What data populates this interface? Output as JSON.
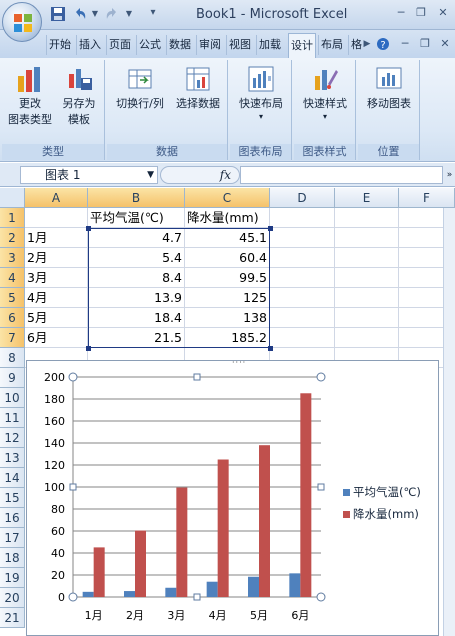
{
  "window": {
    "title": "Book1 - Microsoft Excel",
    "controls": {
      "minimize": "─",
      "restore": "❐",
      "close": "✕"
    }
  },
  "tabs": [
    {
      "label": "开始"
    },
    {
      "label": "插入"
    },
    {
      "label": "页面"
    },
    {
      "label": "公式"
    },
    {
      "label": "数据"
    },
    {
      "label": "审阅"
    },
    {
      "label": "视图"
    },
    {
      "label": "加载"
    },
    {
      "label": "设计",
      "active": true
    },
    {
      "label": "布局"
    },
    {
      "label": "格"
    }
  ],
  "ribbon": {
    "groups": [
      {
        "label": "类型",
        "buttons": [
          {
            "label": "更改\n图表类型",
            "icon": "change-chart-type-icon"
          },
          {
            "label": "另存为\n模板",
            "icon": "save-template-icon"
          }
        ]
      },
      {
        "label": "数据",
        "buttons": [
          {
            "label": "切换行/列",
            "icon": "switch-row-col-icon"
          },
          {
            "label": "选择数据",
            "icon": "select-data-icon"
          }
        ]
      },
      {
        "label": "图表布局",
        "buttons": [
          {
            "label": "快速布局",
            "icon": "quick-layout-icon"
          }
        ]
      },
      {
        "label": "图表样式",
        "buttons": [
          {
            "label": "快速样式",
            "icon": "quick-style-icon"
          }
        ]
      },
      {
        "label": "位置",
        "buttons": [
          {
            "label": "移动图表",
            "icon": "move-chart-icon"
          }
        ]
      }
    ]
  },
  "formula_bar": {
    "name_box": "图表 1",
    "fx": "fx",
    "value": ""
  },
  "sheet": {
    "columns": [
      "A",
      "B",
      "C",
      "D",
      "E",
      "F"
    ],
    "rows": [
      "1",
      "2",
      "3",
      "4",
      "5",
      "6",
      "7",
      "8",
      "9",
      "10",
      "11",
      "12",
      "13",
      "14",
      "15",
      "16",
      "17",
      "18",
      "19",
      "20",
      "21"
    ],
    "headers": [
      "",
      "平均气温(℃)",
      "降水量(mm)"
    ],
    "data": [
      [
        "1月",
        "4.7",
        "45.1"
      ],
      [
        "2月",
        "5.4",
        "60.4"
      ],
      [
        "3月",
        "8.4",
        "99.5"
      ],
      [
        "4月",
        "13.9",
        "125"
      ],
      [
        "5月",
        "18.4",
        "138"
      ],
      [
        "6月",
        "21.5",
        "185.2"
      ]
    ]
  },
  "chart_data": {
    "type": "bar",
    "categories": [
      "1月",
      "2月",
      "3月",
      "4月",
      "5月",
      "6月"
    ],
    "series": [
      {
        "name": "平均气温(℃)",
        "values": [
          4.7,
          5.4,
          8.4,
          13.9,
          18.4,
          21.5
        ],
        "color": "#4f81bd"
      },
      {
        "name": "降水量(mm)",
        "values": [
          45.1,
          60.4,
          99.5,
          125,
          138,
          185.2
        ],
        "color": "#c0504d"
      }
    ],
    "yticks": [
      "0",
      "20",
      "40",
      "60",
      "80",
      "100",
      "120",
      "140",
      "160",
      "180",
      "200"
    ],
    "ylim": [
      0,
      200
    ],
    "grid": true,
    "legend": "right"
  }
}
